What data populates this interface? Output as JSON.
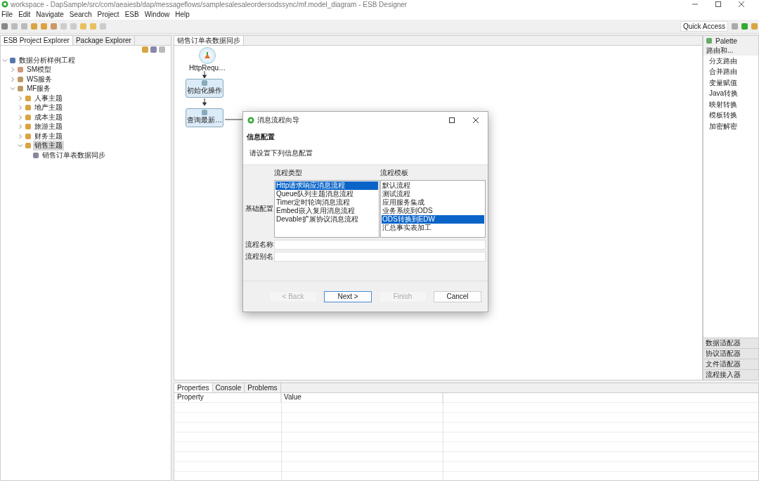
{
  "window": {
    "title": "workspace - DapSample/src/com/aeaiesb/dap/messageflows/samplesalesaleordersodssync/mf.model_diagram - ESB Designer"
  },
  "menu": [
    "File",
    "Edit",
    "Navigate",
    "Search",
    "Project",
    "ESB",
    "Window",
    "Help"
  ],
  "quick_access": "Quick Access",
  "explorer": {
    "tabs": [
      {
        "label": "ESB Project Explorer",
        "selected": true
      },
      {
        "label": "Package Explorer",
        "selected": false
      }
    ],
    "tree": [
      {
        "label": "数据分析样例工程",
        "kind": "project",
        "expanded": true,
        "selected": false,
        "children": [
          {
            "label": "SM模型",
            "kind": "model",
            "expanded": false,
            "selected": false
          },
          {
            "label": "WS服务",
            "kind": "service",
            "expanded": false,
            "selected": false
          },
          {
            "label": "MF服务",
            "kind": "service",
            "expanded": true,
            "selected": false,
            "children": [
              {
                "label": "人事主题",
                "kind": "folder",
                "expanded": false,
                "selected": false
              },
              {
                "label": "地产主题",
                "kind": "folder",
                "expanded": false,
                "selected": false
              },
              {
                "label": "成本主题",
                "kind": "folder",
                "expanded": false,
                "selected": false
              },
              {
                "label": "旅游主题",
                "kind": "folder",
                "expanded": false,
                "selected": false
              },
              {
                "label": "财务主题",
                "kind": "folder",
                "expanded": false,
                "selected": false
              },
              {
                "label": "销售主题",
                "kind": "folder",
                "expanded": true,
                "selected": true,
                "children": [
                  {
                    "label": "销售订单表数据同步",
                    "kind": "flow",
                    "selected": false
                  }
                ]
              }
            ]
          }
        ]
      }
    ]
  },
  "editor": {
    "tab": "销售订单表数据同步",
    "nodes": [
      {
        "label": "HttpRequ…",
        "kind": "start"
      },
      {
        "label": "初始化操作",
        "kind": "task"
      },
      {
        "label": "查询最新…",
        "kind": "task"
      }
    ]
  },
  "dialog": {
    "title": "消息流程向导",
    "heading": "信息配置",
    "description": "请设置下列信息配置",
    "group_label": "基础配置",
    "type_list": {
      "header": "流程类型",
      "items": [
        {
          "label": "Http请求响应消息流程",
          "selected": true
        },
        {
          "label": "Queue队列主题消息流程",
          "selected": false
        },
        {
          "label": "Timer定时轮询消息流程",
          "selected": false
        },
        {
          "label": "Embed嵌入复用消息流程",
          "selected": false
        },
        {
          "label": "Devable扩展协议消息流程",
          "selected": false
        }
      ]
    },
    "template_list": {
      "header": "流程模板",
      "items": [
        {
          "label": "默认流程",
          "selected": false
        },
        {
          "label": "测试流程",
          "selected": false
        },
        {
          "label": "应用服务集成",
          "selected": false
        },
        {
          "label": "业务系统到ODS",
          "selected": false
        },
        {
          "label": "ODS转换到EDW",
          "selected": true
        },
        {
          "label": "汇总事实表加工",
          "selected": false
        }
      ]
    },
    "fields": [
      {
        "label": "流程名称"
      },
      {
        "label": "流程别名"
      }
    ],
    "buttons": [
      {
        "label": "< Back",
        "disabled": true,
        "default": false
      },
      {
        "label": "Next >",
        "disabled": false,
        "default": true
      },
      {
        "label": "Finish",
        "disabled": true,
        "default": false
      },
      {
        "label": "Cancel",
        "disabled": false,
        "default": false
      }
    ]
  },
  "palette": {
    "title": "Palette",
    "drawer": "路由和...",
    "items": [
      "分支路由",
      "合并路由",
      "变量赋值",
      "Java转换",
      "映射转换",
      "模板转换",
      "加密解密"
    ],
    "drawers": [
      "数据适配器",
      "协议适配器",
      "文件适配器",
      "流程接入器"
    ]
  },
  "properties": {
    "tabs": [
      {
        "label": "Properties",
        "selected": true
      },
      {
        "label": "Console",
        "selected": false
      },
      {
        "label": "Problems",
        "selected": false
      }
    ],
    "columns": [
      "Property",
      "Value"
    ]
  }
}
